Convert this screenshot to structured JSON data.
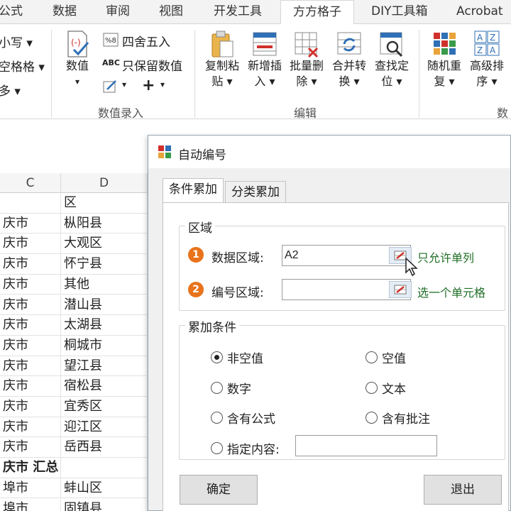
{
  "ribbon_tabs": [
    "公式",
    "数据",
    "审阅",
    "视图",
    "开发工具",
    "方方格子",
    "DIY工具箱",
    "Acrobat"
  ],
  "active_tab": "方方格子",
  "ribbon": {
    "partial_left_items": [
      "小写",
      "空格格",
      "多"
    ],
    "value_button": "数值",
    "round_label": "四舍五入",
    "keep_value_label": "只保留数值",
    "abc_label": "ABC",
    "plus_label": "+",
    "group_value_entry": "数值录入",
    "copy_paste": [
      "复制粘",
      "贴"
    ],
    "insert_new": [
      "新增插",
      "入"
    ],
    "batch_delete": [
      "批量删",
      "除"
    ],
    "merge_convert": [
      "合并转",
      "换"
    ],
    "find_locate": [
      "查找定",
      "位"
    ],
    "group_edit": "编辑",
    "random_repeat": [
      "随机重",
      "复"
    ],
    "advanced_sort": [
      "高级排",
      "序"
    ],
    "group_partial_right": "数"
  },
  "sheet": {
    "columns": [
      "C",
      "D"
    ],
    "rows": [
      {
        "c": "",
        "d": "区"
      },
      {
        "c": "庆市",
        "d": "枞阳县"
      },
      {
        "c": "庆市",
        "d": "大观区"
      },
      {
        "c": "庆市",
        "d": "怀宁县"
      },
      {
        "c": "庆市",
        "d": "其他"
      },
      {
        "c": "庆市",
        "d": "潜山县"
      },
      {
        "c": "庆市",
        "d": "太湖县"
      },
      {
        "c": "庆市",
        "d": "桐城市"
      },
      {
        "c": "庆市",
        "d": "望江县"
      },
      {
        "c": "庆市",
        "d": "宿松县"
      },
      {
        "c": "庆市",
        "d": "宜秀区"
      },
      {
        "c": "庆市",
        "d": "迎江区"
      },
      {
        "c": "庆市",
        "d": "岳西县"
      },
      {
        "c": "庆市 汇总",
        "d": ""
      },
      {
        "c": "埠市",
        "d": "蚌山区"
      },
      {
        "c": "埠市",
        "d": "固镇县"
      }
    ]
  },
  "dialog": {
    "title": "自动编号",
    "tabs": [
      "条件累加",
      "分类累加"
    ],
    "region_group": "区域",
    "data_region_label": "数据区域:",
    "data_region_value": "A2",
    "data_region_hint": "只允许单列",
    "number_region_label": "编号区域:",
    "number_region_value": "",
    "number_region_hint": "选一个单元格",
    "badge_1": "1",
    "badge_2": "2",
    "condition_group": "累加条件",
    "conditions": [
      "非空值",
      "空值",
      "数字",
      "文本",
      "含有公式",
      "含有批注",
      "指定内容:"
    ],
    "selected_condition": "非空值",
    "specified_content_value": "",
    "ok_button": "确定",
    "exit_button": "退出"
  },
  "colors": {
    "badge_orange": "#e8731a",
    "hint_green": "#1f6e25",
    "dialog_bg": "#f0f0f0"
  }
}
